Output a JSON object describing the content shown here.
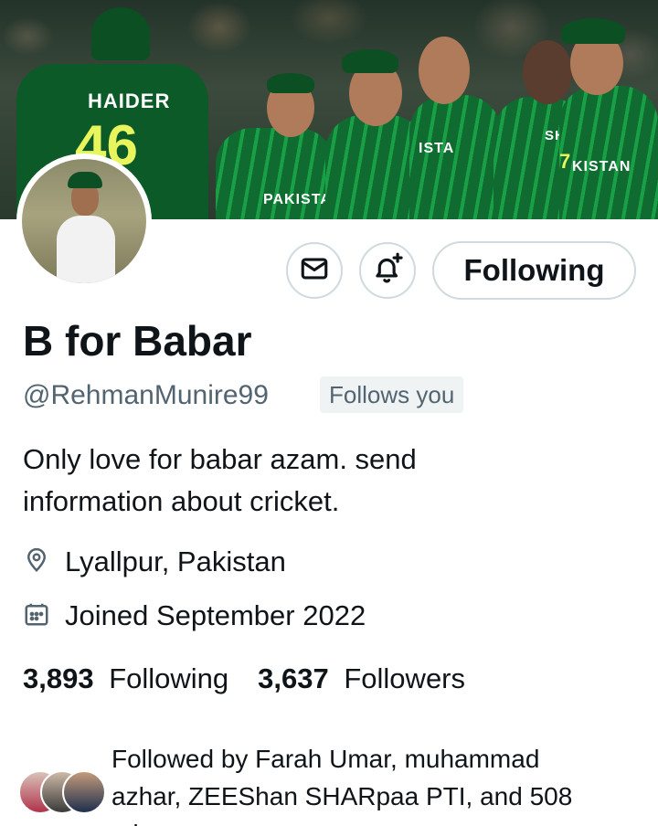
{
  "banner": {
    "jersey_texts": [
      "HAIDER",
      "46",
      "PAKISTAN",
      "ISTA",
      "SHADAB",
      "KISTAN",
      "7"
    ]
  },
  "actions": {
    "message_icon": "mail-icon",
    "notify_icon": "bell-plus-icon",
    "follow_label": "Following"
  },
  "profile": {
    "display_name": "B for Babar",
    "handle": "@RehmanMunire99",
    "follows_you_badge": "Follows you",
    "bio_line1": "Only love for babar azam.  send",
    "bio_line2": "information about cricket.",
    "location": "Lyallpur, Pakistan",
    "joined": "Joined September 2022",
    "location_icon": "location-pin-icon",
    "calendar_icon": "calendar-icon"
  },
  "stats": {
    "following_count": "3,893",
    "following_label": "Following",
    "followers_count": "3,637",
    "followers_label": "Followers"
  },
  "followed_by": {
    "line1": "Followed by Farah Umar, muhammad",
    "line2": "azhar, ZEEShan SHARpaa PTI, and 508",
    "line3": "oth"
  },
  "colors": {
    "text_primary": "#0f1419",
    "text_secondary": "#536471",
    "border": "#cfd9de",
    "badge_bg": "#eff3f4",
    "jersey_green": "#0f6b2f"
  }
}
